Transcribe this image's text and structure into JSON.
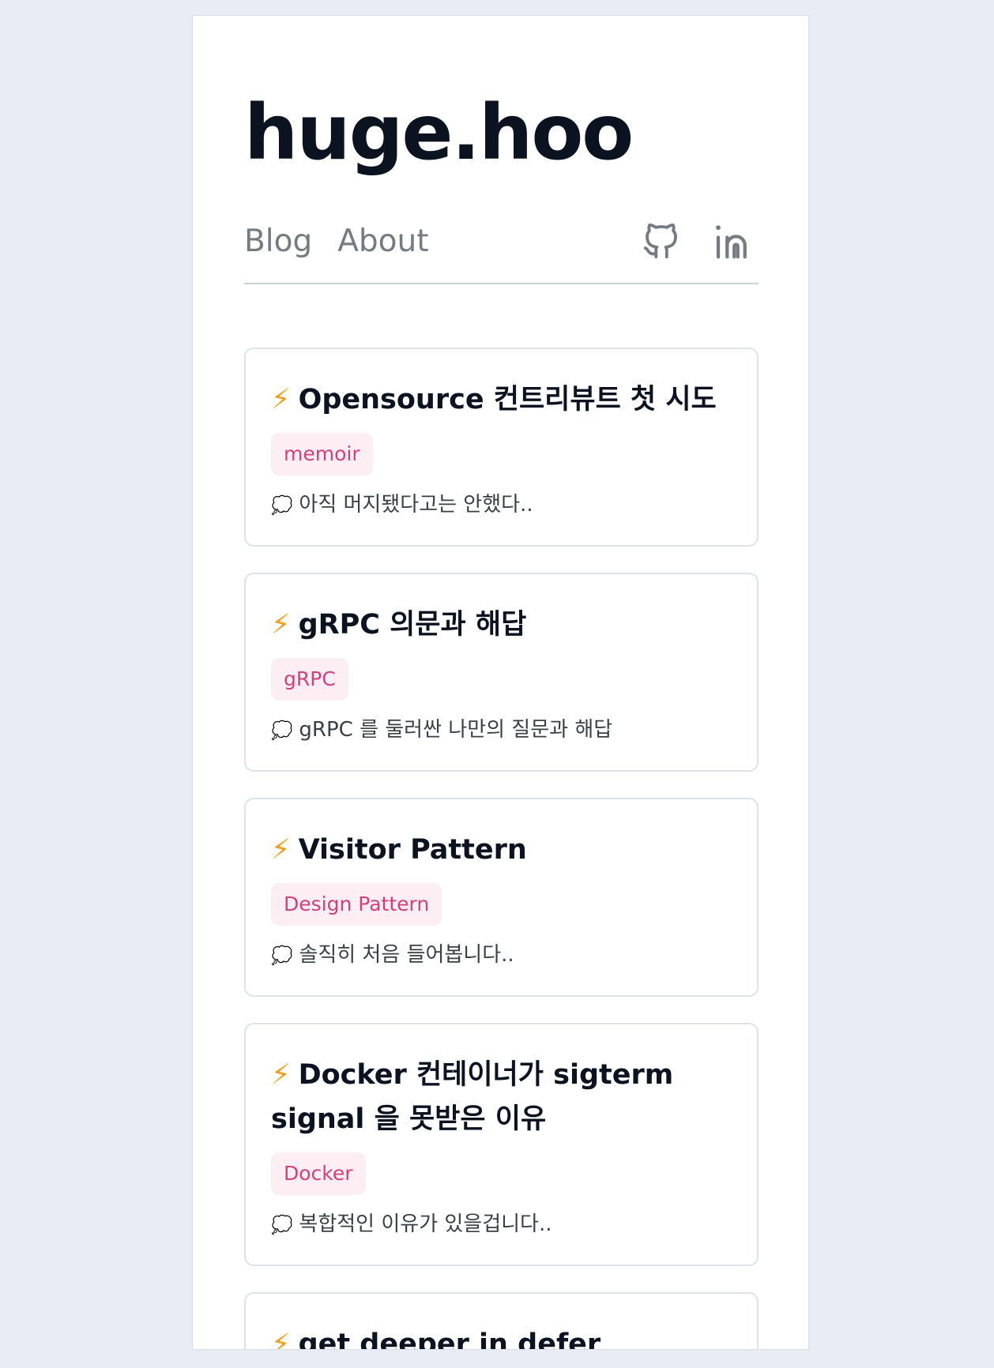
{
  "site": {
    "title": "huge.hoo"
  },
  "nav": {
    "links": [
      "Blog",
      "About"
    ],
    "icons": [
      "github-icon",
      "linkedin-icon"
    ]
  },
  "posts": [
    {
      "icon": "⚡",
      "title": "Opensource 컨트리뷰트 첫 시도",
      "tag": "memoir",
      "desc_icon": "💭",
      "description": "아직 머지됐다고는 안했다.."
    },
    {
      "icon": "⚡",
      "title": "gRPC 의문과 해답",
      "tag": "gRPC",
      "desc_icon": "💭",
      "description": "gRPC 를 둘러싼 나만의 질문과 해답"
    },
    {
      "icon": "⚡",
      "title": "Visitor Pattern",
      "tag": "Design Pattern",
      "desc_icon": "💭",
      "description": "솔직히 처음 들어봅니다.."
    },
    {
      "icon": "⚡",
      "title": "Docker 컨테이너가 sigterm signal 을 못받은 이유",
      "tag": "Docker",
      "desc_icon": "💭",
      "description": "복합적인 이유가 있을겁니다.."
    },
    {
      "icon": "⚡",
      "title": "get deeper in defer",
      "tag": "",
      "desc_icon": "",
      "description": ""
    }
  ],
  "colors": {
    "background": "#e8edf5",
    "title": "#0b1220",
    "nav_text": "#767b82",
    "tag_bg": "#fdeef3",
    "tag_text": "#d4407a",
    "bolt": "#f0a020"
  }
}
